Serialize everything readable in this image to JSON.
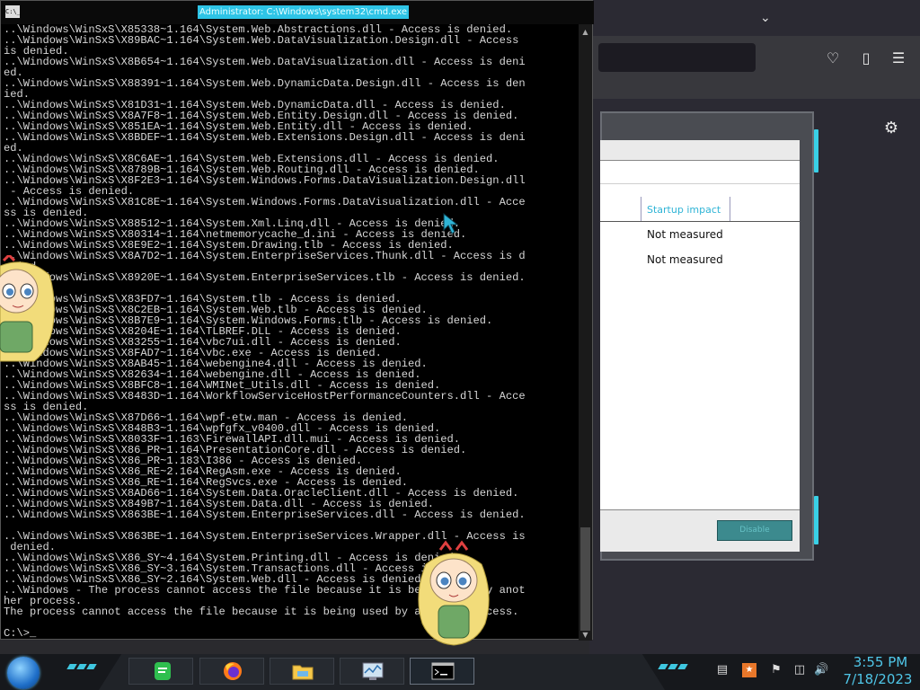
{
  "cmd": {
    "title": "Administrator: C:\\Windows\\system32\\cmd.exe",
    "icon_label": "C:\\_",
    "lines": [
      "..\\Windows\\WinSxS\\X85338~1.164\\System.Web.Abstractions.dll - Access is denied.",
      "..\\Windows\\WinSxS\\X89BAC~1.164\\System.Web.DataVisualization.Design.dll - Access",
      "is denied.",
      "..\\Windows\\WinSxS\\X8B654~1.164\\System.Web.DataVisualization.dll - Access is deni",
      "ed.",
      "..\\Windows\\WinSxS\\X88391~1.164\\System.Web.DynamicData.Design.dll - Access is den",
      "ied.",
      "..\\Windows\\WinSxS\\X81D31~1.164\\System.Web.DynamicData.dll - Access is denied.",
      "..\\Windows\\WinSxS\\X8A7F8~1.164\\System.Web.Entity.Design.dll - Access is denied.",
      "..\\Windows\\WinSxS\\X851EA~1.164\\System.Web.Entity.dll - Access is denied.",
      "..\\Windows\\WinSxS\\X8BDEF~1.164\\System.Web.Extensions.Design.dll - Access is deni",
      "ed.",
      "..\\Windows\\WinSxS\\X8C6AE~1.164\\System.Web.Extensions.dll - Access is denied.",
      "..\\Windows\\WinSxS\\X8789B~1.164\\System.Web.Routing.dll - Access is denied.",
      "..\\Windows\\WinSxS\\X8F2E3~1.164\\System.Windows.Forms.DataVisualization.Design.dll",
      " - Access is denied.",
      "..\\Windows\\WinSxS\\X81C8E~1.164\\System.Windows.Forms.DataVisualization.dll - Acce",
      "ss is denied.",
      "..\\Windows\\WinSxS\\X88512~1.164\\System.Xml.Linq.dll - Access is denied.",
      "..\\Windows\\WinSxS\\X80314~1.164\\netmemorycache_d.ini - Access is denied.",
      "..\\Windows\\WinSxS\\X8E9E2~1.164\\System.Drawing.tlb - Access is denied.",
      "..\\Windows\\WinSxS\\X8A7D2~1.164\\System.EnterpriseServices.Thunk.dll - Access is d",
      "enied.",
      "..\\Windows\\WinSxS\\X8920E~1.164\\System.EnterpriseServices.tlb - Access is denied.",
      "",
      "..\\Windows\\WinSxS\\X83FD7~1.164\\System.tlb - Access is denied.",
      "..\\Windows\\WinSxS\\X8C2EB~1.164\\System.Web.tlb - Access is denied.",
      "..\\Windows\\WinSxS\\X8B7E9~1.164\\System.Windows.Forms.tlb - Access is denied.",
      "..\\Windows\\WinSxS\\X8204E~1.164\\TLBREF.DLL - Access is denied.",
      "..\\Windows\\WinSxS\\X83255~1.164\\vbc7ui.dll - Access is denied.",
      "..\\Windows\\WinSxS\\X8FAD7~1.164\\vbc.exe - Access is denied.",
      "..\\Windows\\WinSxS\\X8AB45~1.164\\webengine4.dll - Access is denied.",
      "..\\Windows\\WinSxS\\X82634~1.164\\webengine.dll - Access is denied.",
      "..\\Windows\\WinSxS\\X8BFC8~1.164\\WMINet_Utils.dll - Access is denied.",
      "..\\Windows\\WinSxS\\X8483D~1.164\\WorkflowServiceHostPerformanceCounters.dll - Acce",
      "ss is denied.",
      "..\\Windows\\WinSxS\\X87D66~1.164\\wpf-etw.man - Access is denied.",
      "..\\Windows\\WinSxS\\X848B3~1.164\\wpfgfx_v0400.dll - Access is denied.",
      "..\\Windows\\WinSxS\\X8033F~1.163\\FirewallAPI.dll.mui - Access is denied.",
      "..\\Windows\\WinSxS\\X86_PR~1.164\\PresentationCore.dll - Access is denied.",
      "..\\Windows\\WinSxS\\X86_PR~1.183\\I386 - Access is denied.",
      "..\\Windows\\WinSxS\\X86_RE~2.164\\RegAsm.exe - Access is denied.",
      "..\\Windows\\WinSxS\\X86_RE~1.164\\RegSvcs.exe - Access is denied.",
      "..\\Windows\\WinSxS\\X8AD66~1.164\\System.Data.OracleClient.dll - Access is denied.",
      "..\\Windows\\WinSxS\\X849B7~1.164\\System.Data.dll - Access is denied.",
      "..\\Windows\\WinSxS\\X863BE~1.164\\System.EnterpriseServices.dll - Access is denied.",
      "",
      "..\\Windows\\WinSxS\\X863BE~1.164\\System.EnterpriseServices.Wrapper.dll - Access is",
      " denied.",
      "..\\Windows\\WinSxS\\X86_SY~4.164\\System.Printing.dll - Access is denied.",
      "..\\Windows\\WinSxS\\X86_SY~3.164\\System.Transactions.dll - Access is denied.",
      "..\\Windows\\WinSxS\\X86_SY~2.164\\System.Web.dll - Access is denied.",
      "..\\Windows - The process cannot access the file because it is being used by anot",
      "her process.",
      "The process cannot access the file because it is being used by another process.",
      "",
      "C:\\>_"
    ]
  },
  "dialog": {
    "column_header": "Startup impact",
    "rows": [
      "Not measured",
      "Not measured"
    ],
    "button_label": "Disable"
  },
  "browser": {
    "icons": [
      "chevron-down-icon",
      "pocket-icon",
      "extensions-icon",
      "menu-icon",
      "gear-icon"
    ]
  },
  "taskbar": {
    "apps": [
      "notes-app",
      "firefox",
      "file-explorer",
      "task-manager",
      "command-prompt"
    ],
    "clock_time": "3:55 PM",
    "clock_date": "7/18/2023"
  },
  "colors": {
    "accent": "#39d0e6",
    "title_highlight": "#2ec4e6",
    "clock": "#4fc6e8"
  }
}
